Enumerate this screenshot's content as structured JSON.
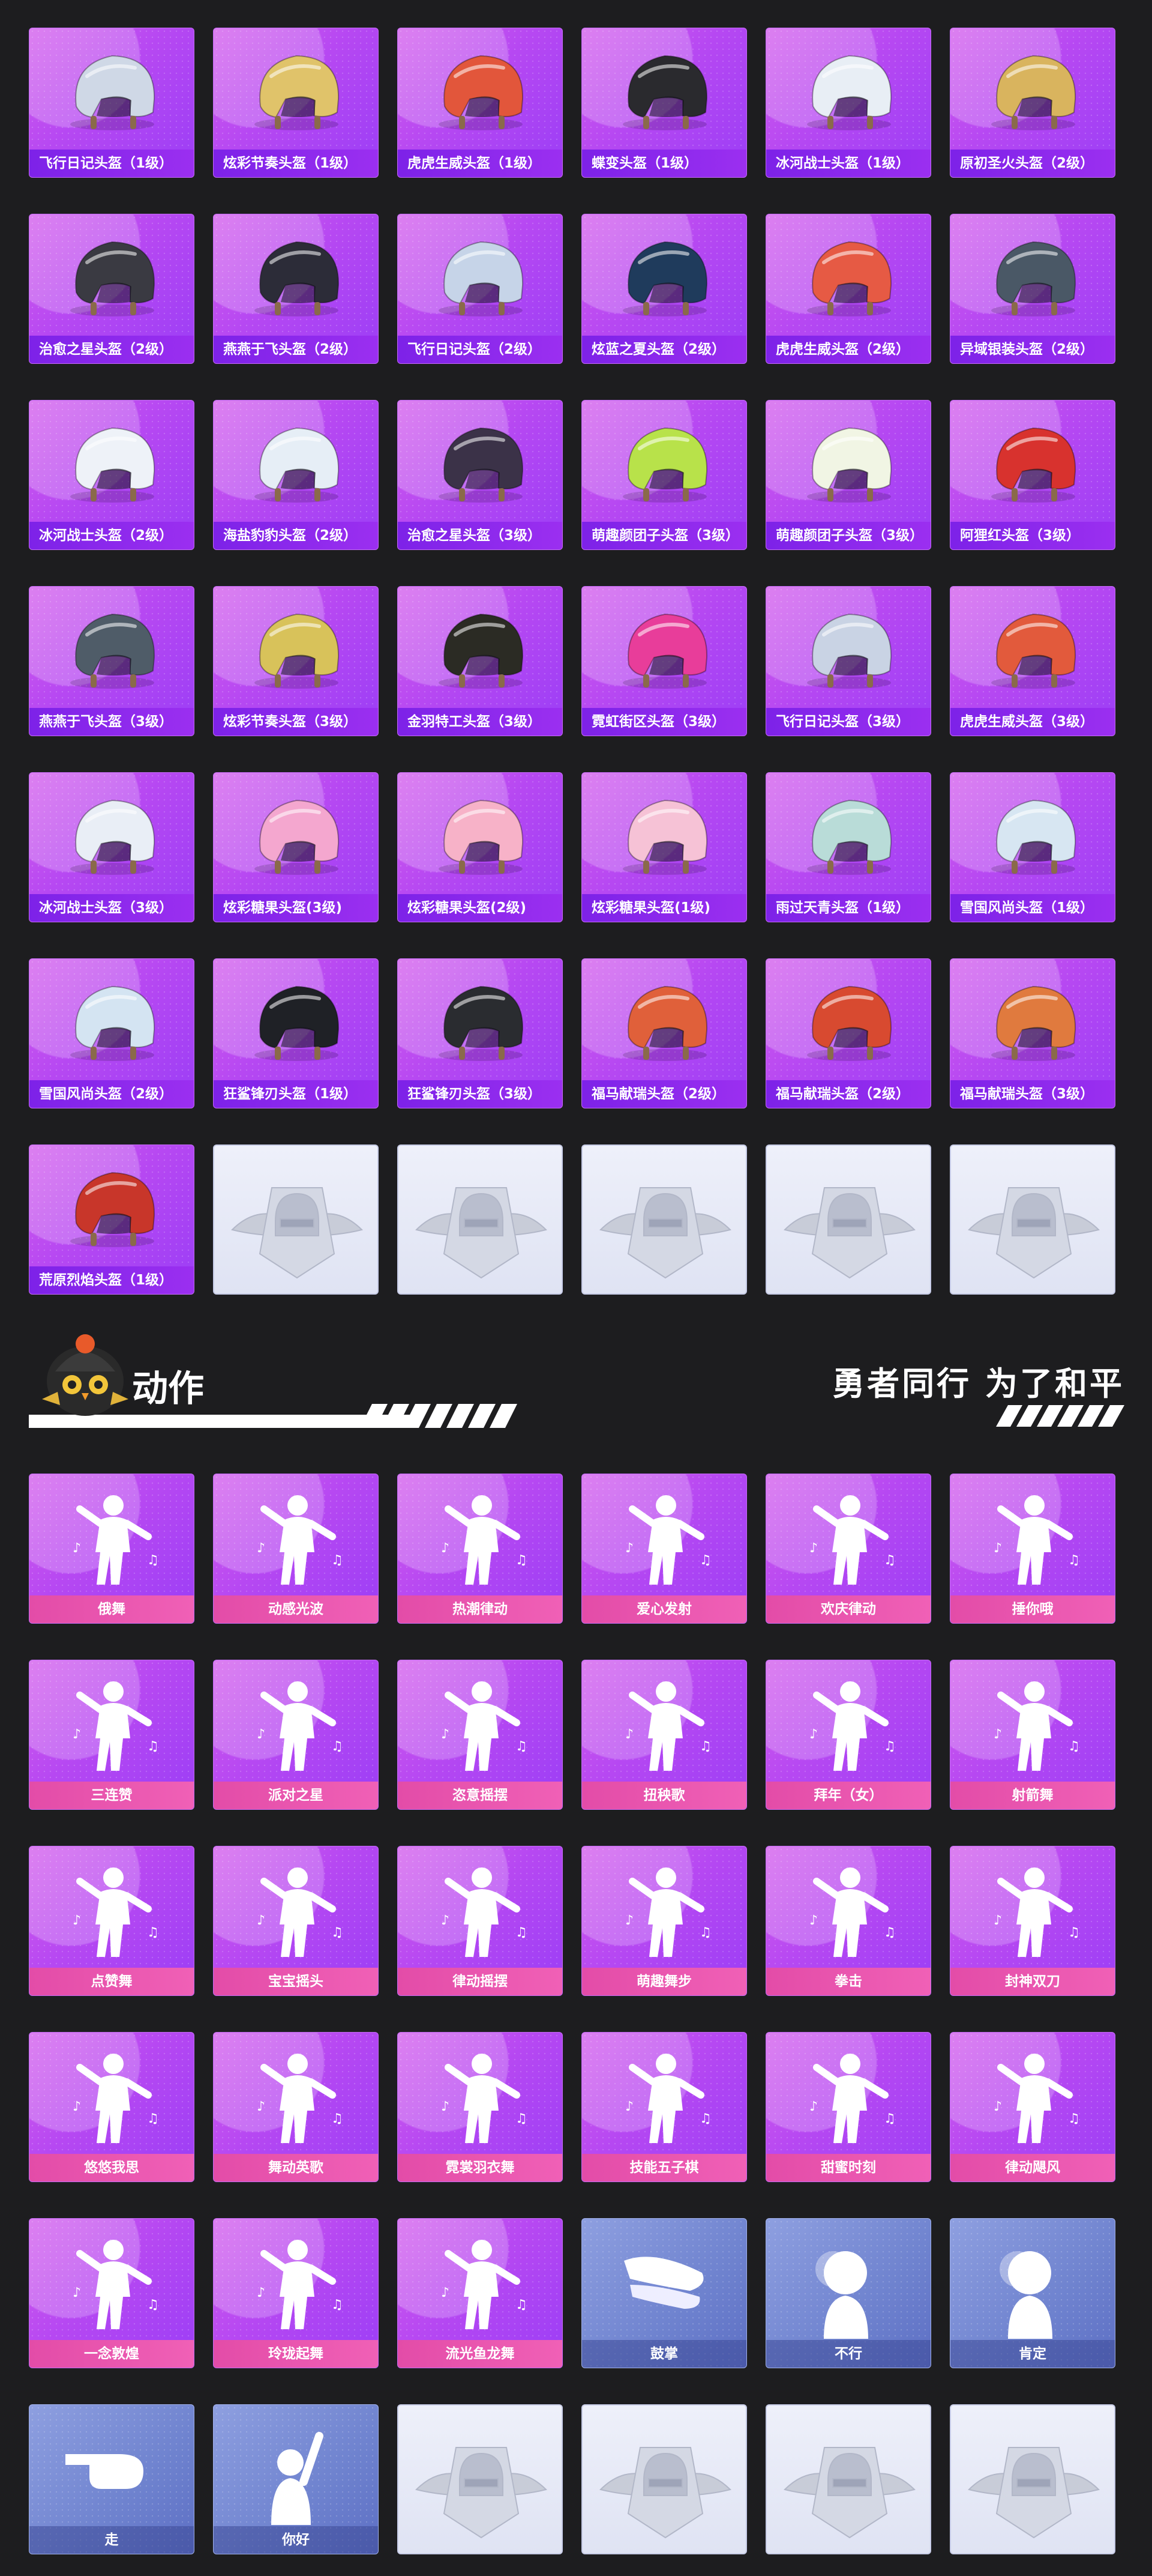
{
  "helmets": [
    {
      "name": "飞行日记头盔（1级）",
      "icon": "helmet-icon",
      "color": "#cfd8e6"
    },
    {
      "name": "炫彩节奏头盔（1级）",
      "icon": "helmet-icon",
      "color": "#e0c36a"
    },
    {
      "name": "虎虎生威头盔（1级）",
      "icon": "helmet-icon",
      "color": "#e2563b"
    },
    {
      "name": "蝶变头盔（1级）",
      "icon": "helmet-icon",
      "color": "#2a2a2e"
    },
    {
      "name": "冰河战士头盔（1级）",
      "icon": "helmet-icon",
      "color": "#e8eef5"
    },
    {
      "name": "原初圣火头盔（2级）",
      "icon": "helmet-icon",
      "color": "#d9b45e"
    },
    {
      "name": "治愈之星头盔（2级）",
      "icon": "helmet-icon",
      "color": "#3a3a42"
    },
    {
      "name": "燕燕于飞头盔（2级）",
      "icon": "helmet-icon",
      "color": "#2c2c38"
    },
    {
      "name": "飞行日记头盔（2级）",
      "icon": "helmet-icon",
      "color": "#c6d4e8"
    },
    {
      "name": "炫蓝之夏头盔（2级）",
      "icon": "helmet-icon",
      "color": "#1f3b5c"
    },
    {
      "name": "虎虎生威头盔（2级）",
      "icon": "helmet-icon",
      "color": "#e65a44"
    },
    {
      "name": "异域银装头盔（2级）",
      "icon": "helmet-icon",
      "color": "#4a5866"
    },
    {
      "name": "冰河战士头盔（2级）",
      "icon": "helmet-icon",
      "color": "#eef2f8"
    },
    {
      "name": "海盐豹豹头盔（2级）",
      "icon": "helmet-icon",
      "color": "#e6eef6"
    },
    {
      "name": "治愈之星头盔（3级）",
      "icon": "helmet-icon",
      "color": "#3b3248"
    },
    {
      "name": "萌趣颜团子头盔（3级）",
      "icon": "helmet-icon",
      "color": "#b8e24a"
    },
    {
      "name": "萌趣颜团子头盔（3级）",
      "icon": "helmet-icon",
      "color": "#f1f5e4"
    },
    {
      "name": "阿狸红头盔（3级）",
      "icon": "helmet-icon",
      "color": "#d8322e"
    },
    {
      "name": "燕燕于飞头盔（3级）",
      "icon": "helmet-icon",
      "color": "#4f5c68"
    },
    {
      "name": "炫彩节奏头盔（3级）",
      "icon": "helmet-icon",
      "color": "#d8c25a"
    },
    {
      "name": "金羽特工头盔（3级）",
      "icon": "helmet-icon",
      "color": "#2b2b24"
    },
    {
      "name": "霓虹街区头盔（3级）",
      "icon": "helmet-icon",
      "color": "#e83d9a"
    },
    {
      "name": "飞行日记头盔（3级）",
      "icon": "helmet-icon",
      "color": "#c9d3e4"
    },
    {
      "name": "虎虎生威头盔（3级）",
      "icon": "helmet-icon",
      "color": "#e25a3c"
    },
    {
      "name": "冰河战士头盔（3级）",
      "icon": "helmet-icon",
      "color": "#e9eef6"
    },
    {
      "name": "炫彩糖果头盔(3级)",
      "icon": "helmet-icon",
      "color": "#f4a7cf"
    },
    {
      "name": "炫彩糖果头盔(2级)",
      "icon": "helmet-icon",
      "color": "#f7b2c8"
    },
    {
      "name": "炫彩糖果头盔(1级)",
      "icon": "helmet-icon",
      "color": "#f6c2d6"
    },
    {
      "name": "雨过天青头盔（1级）",
      "icon": "helmet-icon",
      "color": "#b9dcd8"
    },
    {
      "name": "雪国风尚头盔（1级）",
      "icon": "helmet-icon",
      "color": "#d7e6f2"
    },
    {
      "name": "雪国风尚头盔（2级）",
      "icon": "helmet-icon",
      "color": "#d4e4f2"
    },
    {
      "name": "狂鲨锋刃头盔（1级）",
      "icon": "helmet-icon",
      "color": "#1f2126"
    },
    {
      "name": "狂鲨锋刃头盔（3级）",
      "icon": "helmet-icon",
      "color": "#2a2c30"
    },
    {
      "name": "福马献瑞头盔（2级）",
      "icon": "helmet-icon",
      "color": "#e0603a"
    },
    {
      "name": "福马献瑞头盔（2级）",
      "icon": "helmet-icon",
      "color": "#d84a30"
    },
    {
      "name": "福马献瑞头盔（3级）",
      "icon": "helmet-icon",
      "color": "#e07a3e"
    },
    {
      "name": "荒原烈焰头盔（1级）",
      "icon": "helmet-icon",
      "color": "#c8362a"
    }
  ],
  "emptyHelmetSlots": 5,
  "section": {
    "title": "动作",
    "slogan": "勇者同行 为了和平",
    "mascot_icon": "chicken-mascot-icon"
  },
  "actions": [
    {
      "name": "俄舞",
      "style": "purple",
      "icon": "dancer-icon"
    },
    {
      "name": "动感光波",
      "style": "purple",
      "icon": "dancer-icon"
    },
    {
      "name": "热潮律动",
      "style": "purple",
      "icon": "dancer-icon"
    },
    {
      "name": "爱心发射",
      "style": "purple",
      "icon": "dancer-icon"
    },
    {
      "name": "欢庆律动",
      "style": "purple",
      "icon": "dancer-icon"
    },
    {
      "name": "捶你哦",
      "style": "purple",
      "icon": "dancer-icon"
    },
    {
      "name": "三连赞",
      "style": "purple",
      "icon": "dancer-icon"
    },
    {
      "name": "派对之星",
      "style": "purple",
      "icon": "dancer-icon"
    },
    {
      "name": "恣意摇摆",
      "style": "purple",
      "icon": "dancer-icon"
    },
    {
      "name": "扭秧歌",
      "style": "purple",
      "icon": "dancer-icon"
    },
    {
      "name": "拜年（女）",
      "style": "purple",
      "icon": "dancer-icon"
    },
    {
      "name": "射箭舞",
      "style": "purple",
      "icon": "dancer-icon"
    },
    {
      "name": "点赞舞",
      "style": "purple",
      "icon": "dancer-icon"
    },
    {
      "name": "宝宝摇头",
      "style": "purple",
      "icon": "dancer-icon"
    },
    {
      "name": "律动摇摆",
      "style": "purple",
      "icon": "dancer-icon"
    },
    {
      "name": "萌趣舞步",
      "style": "purple",
      "icon": "dancer-icon"
    },
    {
      "name": "拳击",
      "style": "purple",
      "icon": "dancer-icon"
    },
    {
      "name": "封神双刀",
      "style": "purple",
      "icon": "dancer-icon"
    },
    {
      "name": "悠悠我思",
      "style": "purple",
      "icon": "dancer-icon"
    },
    {
      "name": "舞动英歌",
      "style": "purple",
      "icon": "dancer-icon"
    },
    {
      "name": "霓裳羽衣舞",
      "style": "purple",
      "icon": "dancer-icon"
    },
    {
      "name": "技能五子棋",
      "style": "purple",
      "icon": "dancer-icon"
    },
    {
      "name": "甜蜜时刻",
      "style": "purple",
      "icon": "dancer-icon"
    },
    {
      "name": "律动飓风",
      "style": "purple",
      "icon": "dancer-icon"
    },
    {
      "name": "一念敦煌",
      "style": "purple",
      "icon": "dancer-icon"
    },
    {
      "name": "玲珑起舞",
      "style": "purple",
      "icon": "dancer-icon"
    },
    {
      "name": "流光鱼龙舞",
      "style": "purple",
      "icon": "dancer-icon"
    },
    {
      "name": "鼓掌",
      "style": "blue",
      "icon": "clap-icon"
    },
    {
      "name": "不行",
      "style": "blue",
      "icon": "head-shake-icon"
    },
    {
      "name": "肯定",
      "style": "blue",
      "icon": "head-nod-icon"
    },
    {
      "name": "走",
      "style": "blue",
      "icon": "pointing-hand-icon"
    },
    {
      "name": "你好",
      "style": "blue",
      "icon": "wave-icon"
    }
  ],
  "emptyActionSlots": 4,
  "empty_slot_icon": "pubg-emblem-icon"
}
